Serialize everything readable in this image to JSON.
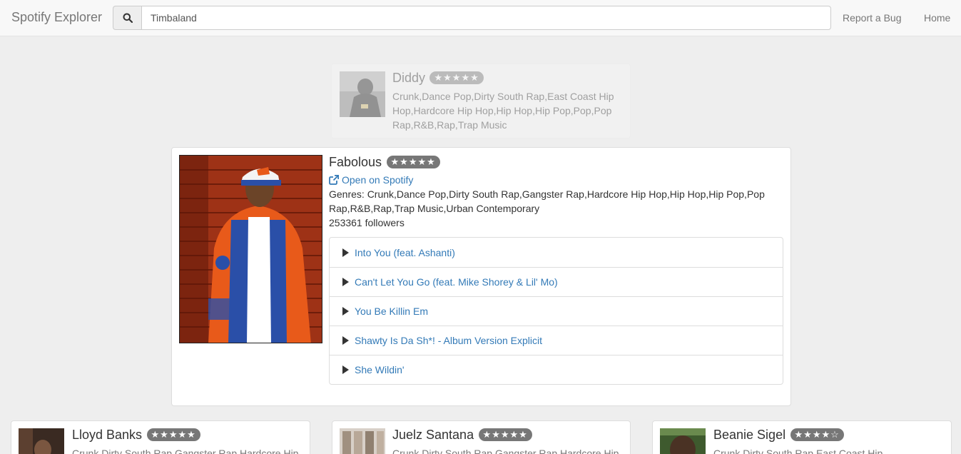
{
  "navbar": {
    "brand": "Spotify Explorer",
    "search_value": "Timbaland",
    "report_label": "Report a Bug",
    "home_label": "Home"
  },
  "previous_artist": {
    "name": "Diddy",
    "rating": "★★★★★",
    "genres": "Crunk,Dance Pop,Dirty South Rap,East Coast Hip Hop,Hardcore Hip Hop,Hip Hop,Hip Pop,Pop,Pop Rap,R&B,Rap,Trap Music"
  },
  "current_artist": {
    "name": "Fabolous",
    "rating": "★★★★★",
    "spotify_label": "Open on Spotify",
    "genres_text": "Genres: Crunk,Dance Pop,Dirty South Rap,Gangster Rap,Hardcore Hip Hop,Hip Hop,Hip Pop,Pop Rap,R&B,Rap,Trap Music,Urban Contemporary",
    "followers_text": "253361 followers",
    "tracks": [
      "Into You (feat. Ashanti)",
      "Can't Let You Go (feat. Mike Shorey & Lil' Mo)",
      "You Be Killin Em",
      "Shawty Is Da Sh*! - Album Version Explicit",
      "She Wildin'"
    ]
  },
  "related_artists": [
    {
      "name": "Lloyd Banks",
      "rating": "★★★★★",
      "genres": "Crunk,Dirty South Rap,Gangster Rap,Hardcore Hip"
    },
    {
      "name": "Juelz Santana",
      "rating": "★★★★★",
      "genres": "Crunk,Dirty South Rap,Gangster Rap,Hardcore Hip"
    },
    {
      "name": "Beanie Sigel",
      "rating": "★★★★☆",
      "genres": "Crunk,Dirty South Rap,East Coast Hip"
    }
  ],
  "colors": {
    "link": "#337ab7",
    "badge": "#777777",
    "background": "#eeeeee"
  }
}
